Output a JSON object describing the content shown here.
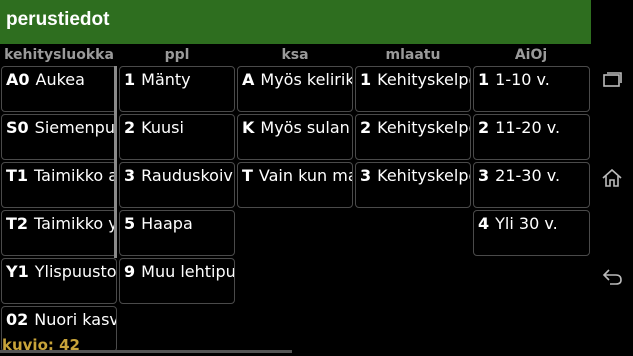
{
  "app": {
    "title": "perustiedot"
  },
  "columns": [
    {
      "header": "kehitysluokka",
      "items": [
        {
          "code": "A0",
          "label": "Aukea"
        },
        {
          "code": "S0",
          "label": "Siemenpuu"
        },
        {
          "code": "T1",
          "label": "Taimikko a"
        },
        {
          "code": "T2",
          "label": "Taimikko y"
        },
        {
          "code": "Y1",
          "label": "Ylispuustoi"
        },
        {
          "code": "02",
          "label": "Nuori kasva"
        }
      ]
    },
    {
      "header": "ppl",
      "items": [
        {
          "code": "1",
          "label": "Mänty"
        },
        {
          "code": "2",
          "label": "Kuusi"
        },
        {
          "code": "3",
          "label": "Rauduskoivu"
        },
        {
          "code": "5",
          "label": "Haapa"
        },
        {
          "code": "9",
          "label": "Muu lehtipuu"
        }
      ]
    },
    {
      "header": "ksa",
      "items": [
        {
          "code": "A",
          "label": "Myös keliriko"
        },
        {
          "code": "K",
          "label": "Myös sulan"
        },
        {
          "code": "T",
          "label": "Vain kun ma"
        }
      ]
    },
    {
      "header": "mlaatu",
      "items": [
        {
          "code": "1",
          "label": "Kehityskelpo"
        },
        {
          "code": "2",
          "label": "Kehityskelpo"
        },
        {
          "code": "3",
          "label": "Kehityskelpo"
        }
      ]
    },
    {
      "header": "AiOj",
      "items": [
        {
          "code": "1",
          "label": "1-10 v."
        },
        {
          "code": "2",
          "label": "11-20 v."
        },
        {
          "code": "3",
          "label": "21-30 v."
        },
        {
          "code": "4",
          "label": "Yli 30 v."
        }
      ]
    }
  ],
  "status": {
    "counter": "kuvio: 42"
  },
  "nav": {
    "icons": [
      "recent-apps-icon",
      "home-icon",
      "back-icon"
    ]
  },
  "colors": {
    "titlebar": "#2e6e1f",
    "counter": "#c8a43a"
  }
}
